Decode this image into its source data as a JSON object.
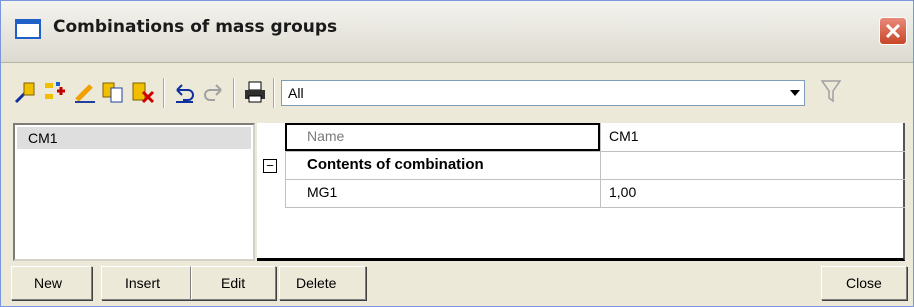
{
  "window": {
    "title": "Combinations of mass groups"
  },
  "toolbar": {
    "icons": [
      "new-item-icon",
      "insert-icon",
      "edit-pencil-icon",
      "copy-icon",
      "delete-icon",
      "undo-icon",
      "redo-icon",
      "print-icon"
    ],
    "filter_value": "All"
  },
  "list": {
    "items": [
      "CM1"
    ]
  },
  "grid": {
    "name_label": "Name",
    "name_value": "CM1",
    "section_label": "Contents of combination",
    "section_toggle": "−",
    "rows": [
      {
        "label": "MG1",
        "value": "1,00"
      }
    ]
  },
  "buttons": {
    "new": "New",
    "insert": "Insert",
    "edit": "Edit",
    "delete": "Delete",
    "close": "Close"
  }
}
